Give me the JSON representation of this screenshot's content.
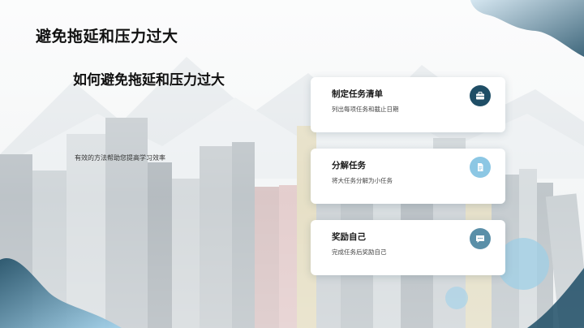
{
  "slide": {
    "title": "避免拖延和压力过大",
    "subtitle": "如何避免拖延和压力过大",
    "description": "有效的方法帮助您提高学习效率"
  },
  "cards": [
    {
      "title": "制定任务清单",
      "text": "列出每项任务和截止日期",
      "icon": "briefcase-icon",
      "icon_bg": "#1f4e66"
    },
    {
      "title": "分解任务",
      "text": "将大任务分解为小任务",
      "icon": "document-icon",
      "icon_bg": "#8cc7e4"
    },
    {
      "title": "奖励自己",
      "text": "完成任务后奖励自己",
      "icon": "chat-icon",
      "icon_bg": "#5a8fa8"
    }
  ],
  "colors": {
    "accent_dark": "#1f4e66",
    "accent_light": "#8cc7e4",
    "accent_mid": "#5a8fa8"
  }
}
